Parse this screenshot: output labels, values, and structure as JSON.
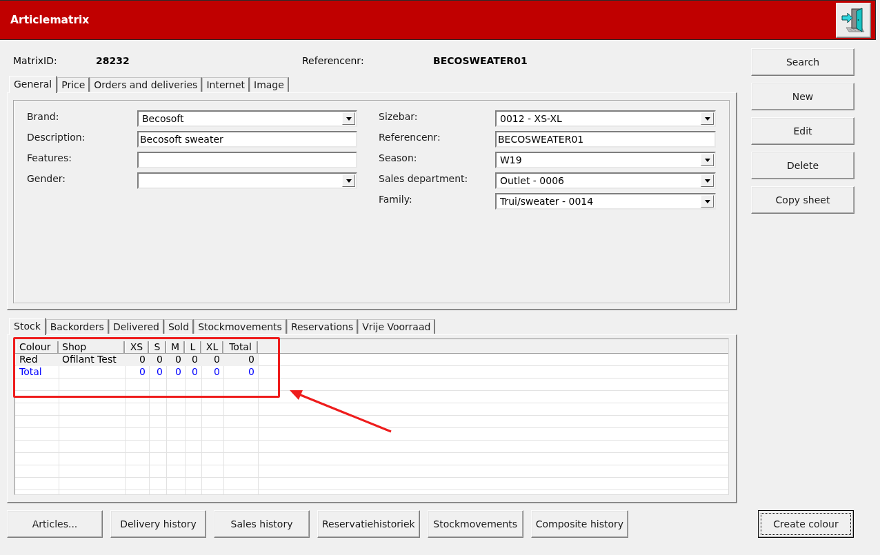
{
  "window": {
    "title": "Articlematrix"
  },
  "header_fields": [
    {
      "label": "MatrixID:",
      "value": "28232"
    },
    {
      "label": "Referencenr:",
      "value": "BECOSWEATER01"
    }
  ],
  "top_tabs": [
    {
      "label": "General",
      "selected": true
    },
    {
      "label": "Price",
      "selected": false
    },
    {
      "label": "Orders and deliveries",
      "selected": false
    },
    {
      "label": "Internet",
      "selected": false
    },
    {
      "label": "Image",
      "selected": false
    }
  ],
  "general_form": {
    "left_fields": [
      {
        "label": "Brand:",
        "kind": "dropdown",
        "value": "Becosoft"
      },
      {
        "label": "Description:",
        "kind": "text",
        "value": "Becosoft sweater"
      },
      {
        "label": "Features:",
        "kind": "text"
      },
      {
        "label": "Gender:",
        "kind": "dropdown"
      }
    ],
    "right_fields": [
      {
        "label": "Sizebar:",
        "kind": "dropdown",
        "value": "0012 - XS-XL"
      },
      {
        "label": "Referencenr:",
        "kind": "text",
        "value": "BECOSWEATER01"
      },
      {
        "label": "Season:",
        "kind": "dropdown",
        "value": "W19"
      },
      {
        "label": "Sales department:",
        "kind": "dropdown",
        "value": "Outlet - 0006"
      },
      {
        "label": "Family:",
        "kind": "dropdown",
        "value": "Trui/sweater - 0014"
      }
    ]
  },
  "side_buttons": [
    {
      "label": "Search"
    },
    {
      "label": "New"
    },
    {
      "label": "Edit"
    },
    {
      "label": "Delete"
    },
    {
      "label": "Copy sheet"
    }
  ],
  "bottom_tabs": [
    {
      "label": "Stock",
      "selected": true
    },
    {
      "label": "Backorders",
      "selected": false
    },
    {
      "label": "Delivered",
      "selected": false
    },
    {
      "label": "Sold",
      "selected": false
    },
    {
      "label": "Stockmovements",
      "selected": false
    },
    {
      "label": "Reservations",
      "selected": false
    },
    {
      "label": "Vrije Voorraad",
      "selected": false
    }
  ],
  "stock_table": {
    "columns": [
      "Colour",
      "Shop",
      "XS",
      "S",
      "M",
      "L",
      "XL",
      "Total"
    ],
    "rows": [
      {
        "kind": "data",
        "colour": "Red",
        "shop": "Ofilant Test",
        "sizes": [
          "0",
          "0",
          "0",
          "0",
          "0"
        ],
        "total": "0"
      },
      {
        "kind": "total",
        "colour": "Total",
        "sizes": [
          "0",
          "0",
          "0",
          "0",
          "0"
        ],
        "total": "0"
      }
    ]
  },
  "bottom_buttons": [
    {
      "label": "Articles..."
    },
    {
      "label": "Delivery history"
    },
    {
      "label": "Sales history"
    },
    {
      "label": "Reservatiehistoriek"
    },
    {
      "label": "Stockmovements"
    },
    {
      "label": "Composite history"
    }
  ],
  "create_button": {
    "label": "Create colour",
    "focused": true
  }
}
